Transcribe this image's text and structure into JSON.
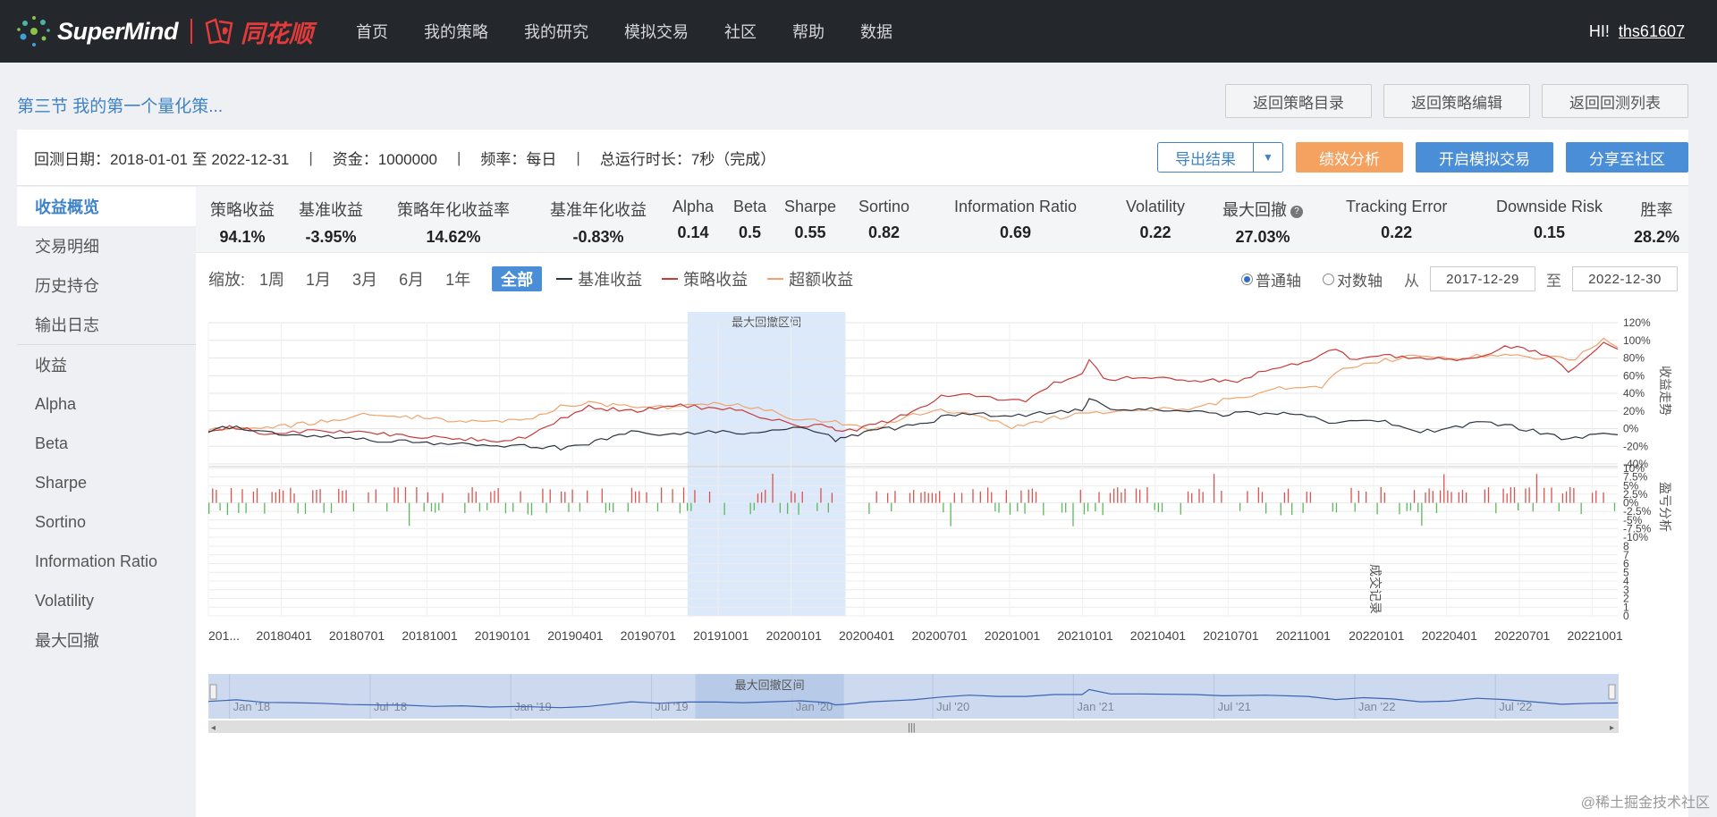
{
  "header": {
    "brand": "SuperMind",
    "partner": "同花顺",
    "nav": [
      "首页",
      "我的策略",
      "我的研究",
      "模拟交易",
      "社区",
      "帮助",
      "数据"
    ],
    "greeting": "HI!",
    "username": "ths61607"
  },
  "page": {
    "title": "第三节 我的第一个量化策...",
    "top_buttons": [
      "返回策略目录",
      "返回策略编辑",
      "返回回测列表"
    ]
  },
  "backtest": {
    "period": "回测日期：2018-01-01 至 2022-12-31",
    "capital": "资金：1000000",
    "frequency": "频率：每日",
    "runtime": "总运行时长：7秒（完成）",
    "sep": "|",
    "export_label": "导出结果",
    "perf_label": "绩效分析",
    "sim_label": "开启模拟交易",
    "share_label": "分享至社区"
  },
  "sidebar": {
    "items": [
      "收益概览",
      "交易明细",
      "历史持仓",
      "输出日志",
      "收益",
      "Alpha",
      "Beta",
      "Sharpe",
      "Sortino",
      "Information Ratio",
      "Volatility",
      "最大回撤"
    ],
    "active": 0
  },
  "metrics": [
    {
      "label": "策略收益",
      "value": "94.1%"
    },
    {
      "label": "基准收益",
      "value": "-3.95%"
    },
    {
      "label": "策略年化收益率",
      "value": "14.62%"
    },
    {
      "label": "基准年化收益",
      "value": "-0.83%"
    },
    {
      "label": "Alpha",
      "value": "0.14"
    },
    {
      "label": "Beta",
      "value": "0.5"
    },
    {
      "label": "Sharpe",
      "value": "0.55"
    },
    {
      "label": "Sortino",
      "value": "0.82"
    },
    {
      "label": "Information Ratio",
      "value": "0.69"
    },
    {
      "label": "Volatility",
      "value": "0.22"
    },
    {
      "label": "最大回撤",
      "value": "27.03%"
    },
    {
      "label": "Tracking Error",
      "value": "0.22"
    },
    {
      "label": "Downside Risk",
      "value": "0.15"
    },
    {
      "label": "胜率",
      "value": "28.2%"
    }
  ],
  "toolbar": {
    "zoom_label": "缩放:",
    "zoom_options": [
      "1周",
      "1月",
      "3月",
      "6月",
      "1年",
      "全部"
    ],
    "active_zoom": 5,
    "axis_normal": "普通轴",
    "axis_log": "对数轴",
    "from_label": "从",
    "from_date": "2017-12-29",
    "to_label": "至",
    "to_date": "2022-12-30"
  },
  "colors": {
    "benchmark": "#2c3440",
    "strategy": "#c83a3a",
    "excess": "#f0a36b",
    "drawdown_band": "#dbe9fb",
    "profit_bar": "#d9534f",
    "loss_bar": "#5cb85c",
    "accent": "#4a8ed8"
  },
  "chart_data": {
    "type": "line",
    "drawdown_label": "最大回撤区间",
    "legend": [
      "基准收益",
      "策略收益",
      "超额收益"
    ],
    "panel_labels": [
      "收益走势",
      "盈亏分析",
      "成交记录"
    ],
    "x_ticks": [
      "201...",
      "20180401",
      "20180701",
      "20181001",
      "20190101",
      "20190401",
      "20190701",
      "20191001",
      "20200101",
      "20200401",
      "20200701",
      "20201001",
      "20210101",
      "20210401",
      "20210701",
      "20211001",
      "20220101",
      "20220401",
      "20220701",
      "20221001"
    ],
    "returns_axis": [
      "120%",
      "100%",
      "80%",
      "60%",
      "40%",
      "20%",
      "0%",
      "-20%",
      "-40%"
    ],
    "returns_ylim": [
      -40,
      120
    ],
    "pnl_axis": [
      "10%",
      "7.5%",
      "5%",
      "2.5%",
      "0%",
      "-2.5%",
      "-5%",
      "-7.5%",
      "-10%"
    ],
    "pnl_ylim": [
      -10,
      10
    ],
    "trades_axis": [
      "8",
      "7",
      "6",
      "5",
      "4",
      "3",
      "2",
      "1",
      "0"
    ],
    "drawdown_range": [
      0.34,
      0.452
    ],
    "x_period": [
      "2018-01-01",
      "2022-12-31"
    ],
    "series": [
      {
        "name": "基准收益",
        "points": [
          [
            0,
            -2
          ],
          [
            0.02,
            3
          ],
          [
            0.04,
            -5
          ],
          [
            0.06,
            -6
          ],
          [
            0.08,
            -8
          ],
          [
            0.1,
            -12
          ],
          [
            0.12,
            -13
          ],
          [
            0.14,
            -14
          ],
          [
            0.16,
            -18
          ],
          [
            0.18,
            -16
          ],
          [
            0.2,
            -20
          ],
          [
            0.22,
            -18
          ],
          [
            0.25,
            -22
          ],
          [
            0.27,
            -18
          ],
          [
            0.3,
            -3
          ],
          [
            0.32,
            -8
          ],
          [
            0.34,
            -4
          ],
          [
            0.36,
            -4
          ],
          [
            0.38,
            -6
          ],
          [
            0.4,
            -3
          ],
          [
            0.42,
            0
          ],
          [
            0.44,
            -6
          ],
          [
            0.445,
            -13
          ],
          [
            0.452,
            -11
          ],
          [
            0.47,
            -3
          ],
          [
            0.5,
            3
          ],
          [
            0.52,
            12
          ],
          [
            0.54,
            18
          ],
          [
            0.56,
            14
          ],
          [
            0.58,
            14
          ],
          [
            0.6,
            20
          ],
          [
            0.62,
            20
          ],
          [
            0.625,
            36
          ],
          [
            0.64,
            22
          ],
          [
            0.66,
            22
          ],
          [
            0.7,
            20
          ],
          [
            0.72,
            16
          ],
          [
            0.75,
            18
          ],
          [
            0.78,
            14
          ],
          [
            0.8,
            4
          ],
          [
            0.82,
            10
          ],
          [
            0.84,
            6
          ],
          [
            0.86,
            -3
          ],
          [
            0.88,
            -1
          ],
          [
            0.9,
            8
          ],
          [
            0.92,
            4
          ],
          [
            0.94,
            -3
          ],
          [
            0.96,
            -11
          ],
          [
            0.98,
            -8
          ],
          [
            1,
            -7
          ]
        ]
      },
      {
        "name": "策略收益",
        "points": [
          [
            0,
            -2
          ],
          [
            0.015,
            2
          ],
          [
            0.04,
            -5
          ],
          [
            0.06,
            -3
          ],
          [
            0.08,
            -2
          ],
          [
            0.12,
            -5
          ],
          [
            0.16,
            -10
          ],
          [
            0.2,
            -13
          ],
          [
            0.21,
            -15
          ],
          [
            0.23,
            -8
          ],
          [
            0.25,
            12
          ],
          [
            0.27,
            24
          ],
          [
            0.3,
            20
          ],
          [
            0.33,
            26
          ],
          [
            0.35,
            24
          ],
          [
            0.37,
            22
          ],
          [
            0.4,
            10
          ],
          [
            0.42,
            2
          ],
          [
            0.44,
            3
          ],
          [
            0.445,
            -3
          ],
          [
            0.46,
            -2
          ],
          [
            0.5,
            18
          ],
          [
            0.52,
            38
          ],
          [
            0.54,
            40
          ],
          [
            0.56,
            34
          ],
          [
            0.58,
            32
          ],
          [
            0.6,
            52
          ],
          [
            0.62,
            62
          ],
          [
            0.625,
            78
          ],
          [
            0.635,
            56
          ],
          [
            0.66,
            58
          ],
          [
            0.7,
            54
          ],
          [
            0.73,
            54
          ],
          [
            0.75,
            66
          ],
          [
            0.76,
            68
          ],
          [
            0.79,
            82
          ],
          [
            0.8,
            92
          ],
          [
            0.81,
            80
          ],
          [
            0.83,
            83
          ],
          [
            0.86,
            80
          ],
          [
            0.89,
            78
          ],
          [
            0.91,
            86
          ],
          [
            0.92,
            94
          ],
          [
            0.95,
            84
          ],
          [
            0.965,
            64
          ],
          [
            0.98,
            82
          ],
          [
            0.99,
            98
          ],
          [
            1,
            90
          ]
        ]
      },
      {
        "name": "超额收益",
        "points": [
          [
            0,
            -2
          ],
          [
            0.02,
            3
          ],
          [
            0.05,
            2
          ],
          [
            0.08,
            8
          ],
          [
            0.11,
            16
          ],
          [
            0.14,
            14
          ],
          [
            0.17,
            10
          ],
          [
            0.2,
            9
          ],
          [
            0.23,
            10
          ],
          [
            0.25,
            26
          ],
          [
            0.27,
            29
          ],
          [
            0.3,
            24
          ],
          [
            0.33,
            25
          ],
          [
            0.35,
            29
          ],
          [
            0.38,
            26
          ],
          [
            0.4,
            19
          ],
          [
            0.42,
            9
          ],
          [
            0.44,
            8
          ],
          [
            0.445,
            7
          ],
          [
            0.47,
            -2
          ],
          [
            0.5,
            16
          ],
          [
            0.52,
            20
          ],
          [
            0.55,
            14
          ],
          [
            0.57,
            1
          ],
          [
            0.6,
            12
          ],
          [
            0.62,
            16
          ],
          [
            0.64,
            20
          ],
          [
            0.66,
            22
          ],
          [
            0.7,
            22
          ],
          [
            0.72,
            32
          ],
          [
            0.74,
            38
          ],
          [
            0.76,
            46
          ],
          [
            0.79,
            48
          ],
          [
            0.8,
            64
          ],
          [
            0.82,
            74
          ],
          [
            0.84,
            78
          ],
          [
            0.86,
            84
          ],
          [
            0.88,
            78
          ],
          [
            0.9,
            82
          ],
          [
            0.92,
            84
          ],
          [
            0.95,
            80
          ],
          [
            0.97,
            80
          ],
          [
            0.99,
            100
          ],
          [
            1,
            92
          ]
        ]
      }
    ]
  },
  "navigator": {
    "drawdown_label": "最大回撤区间",
    "ticks": [
      "Jan '18",
      "Jul '18",
      "Jan '19",
      "Jul '19",
      "Jan '20",
      "Jul '20",
      "Jan '21",
      "Jul '21",
      "Jan '22",
      "Jul '22"
    ]
  },
  "watermark": "@稀土掘金技术社区"
}
